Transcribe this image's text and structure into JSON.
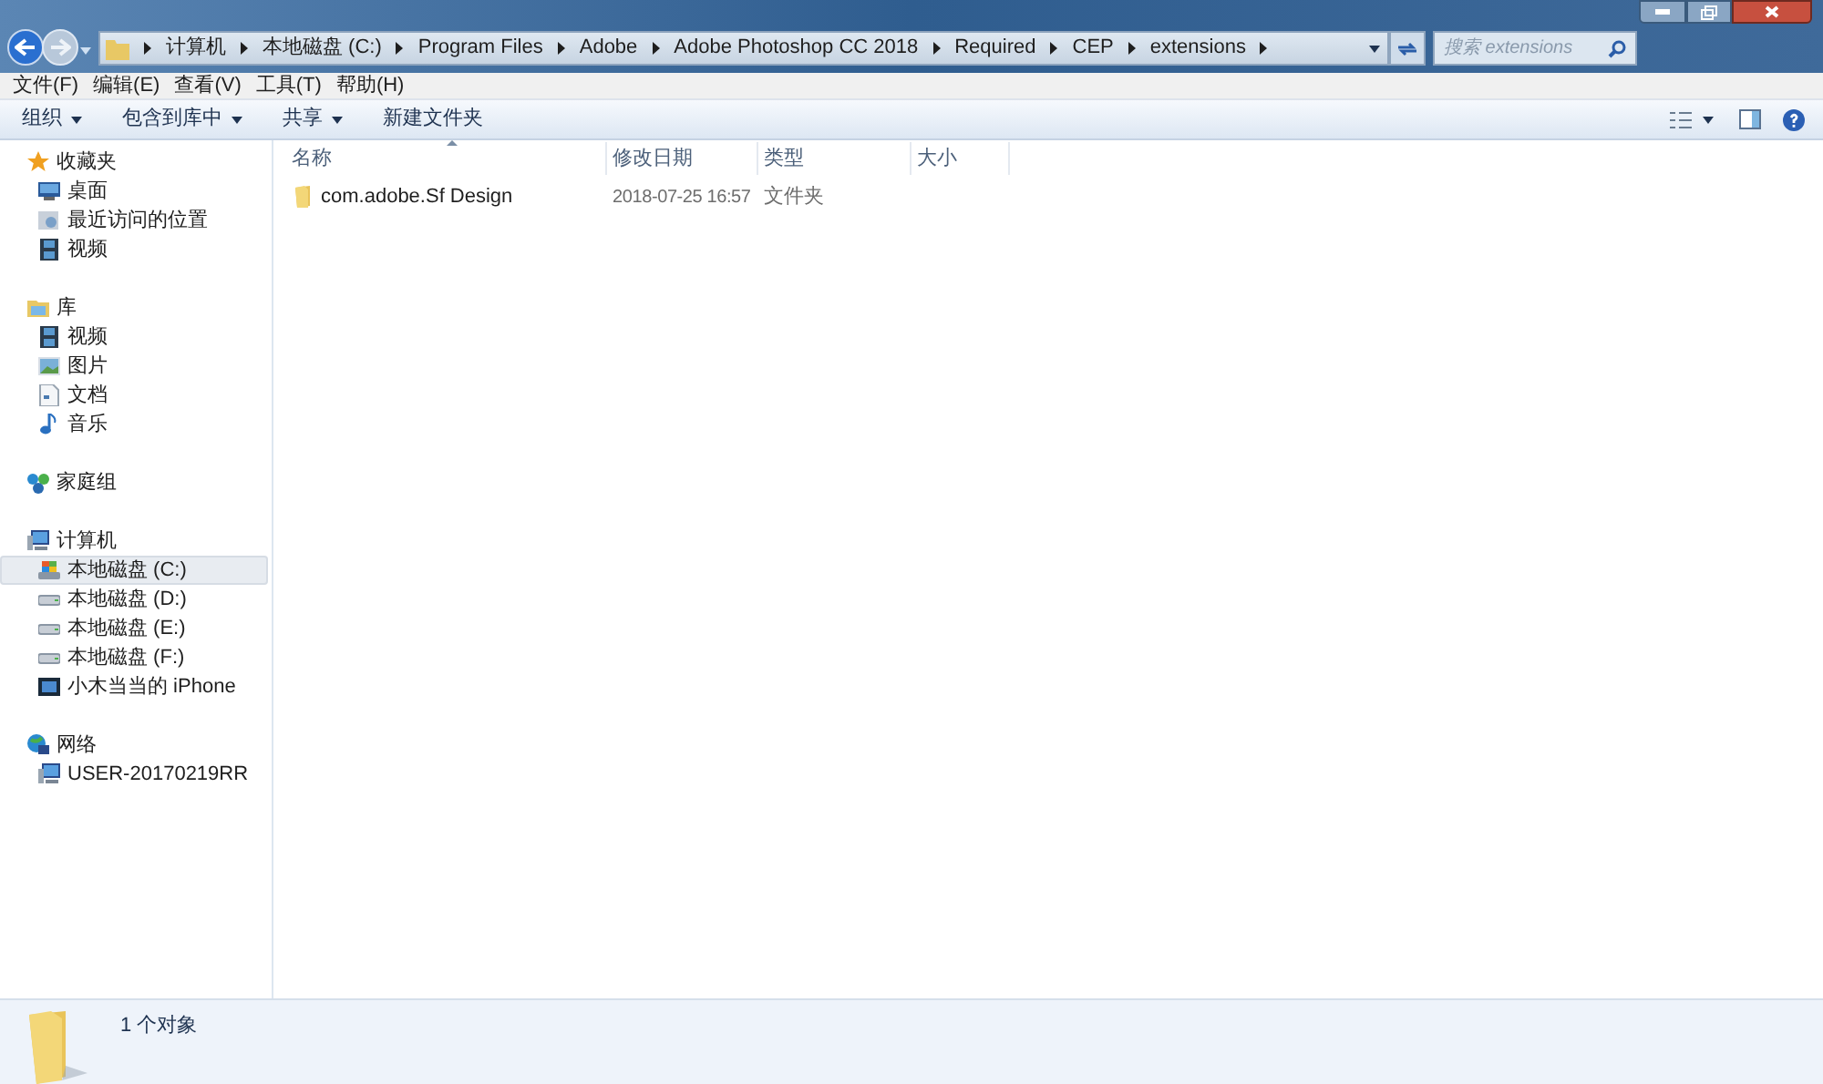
{
  "breadcrumb": [
    "计算机",
    "本地磁盘 (C:)",
    "Program Files",
    "Adobe",
    "Adobe Photoshop CC 2018",
    "Required",
    "CEP",
    "extensions"
  ],
  "search": {
    "placeholder": "搜索 extensions"
  },
  "menu": [
    "文件(F)",
    "编辑(E)",
    "查看(V)",
    "工具(T)",
    "帮助(H)"
  ],
  "toolbar": [
    {
      "label": "组织",
      "dropdown": true
    },
    {
      "label": "包含到库中",
      "dropdown": true
    },
    {
      "label": "共享",
      "dropdown": true
    },
    {
      "label": "新建文件夹",
      "dropdown": false
    }
  ],
  "sidebar": [
    {
      "label": "收藏夹",
      "kind": "star",
      "selected": false,
      "children": [
        {
          "label": "桌面",
          "kind": "desktop",
          "selected": false
        },
        {
          "label": "最近访问的位置",
          "kind": "recent",
          "selected": false
        },
        {
          "label": "视频",
          "kind": "video",
          "selected": false
        }
      ]
    },
    {
      "label": "库",
      "kind": "library",
      "selected": false,
      "children": [
        {
          "label": "视频",
          "kind": "video",
          "selected": false
        },
        {
          "label": "图片",
          "kind": "image",
          "selected": false
        },
        {
          "label": "文档",
          "kind": "document",
          "selected": false
        },
        {
          "label": "音乐",
          "kind": "music",
          "selected": false
        }
      ]
    },
    {
      "label": "家庭组",
      "kind": "homegroup",
      "selected": false
    },
    {
      "label": "计算机",
      "kind": "computer",
      "selected": false,
      "children": [
        {
          "label": "本地磁盘 (C:)",
          "kind": "system-drive",
          "selected": true
        },
        {
          "label": "本地磁盘 (D:)",
          "kind": "drive",
          "selected": false
        },
        {
          "label": "本地磁盘 (E:)",
          "kind": "drive",
          "selected": false
        },
        {
          "label": "本地磁盘 (F:)",
          "kind": "drive",
          "selected": false
        },
        {
          "label": "小木当当的 iPhone",
          "kind": "phone",
          "selected": false
        }
      ]
    },
    {
      "label": "网络",
      "kind": "network",
      "selected": false,
      "children": [
        {
          "label": "USER-20170219RR",
          "kind": "computer",
          "selected": false
        }
      ]
    }
  ],
  "columns": [
    "名称",
    "修改日期",
    "类型",
    "大小"
  ],
  "files": [
    {
      "name": "com.adobe.Sf Design",
      "modified": "2018-07-25 16:57",
      "type": "文件夹"
    }
  ],
  "status_bar": {
    "count": "1 个对象"
  }
}
